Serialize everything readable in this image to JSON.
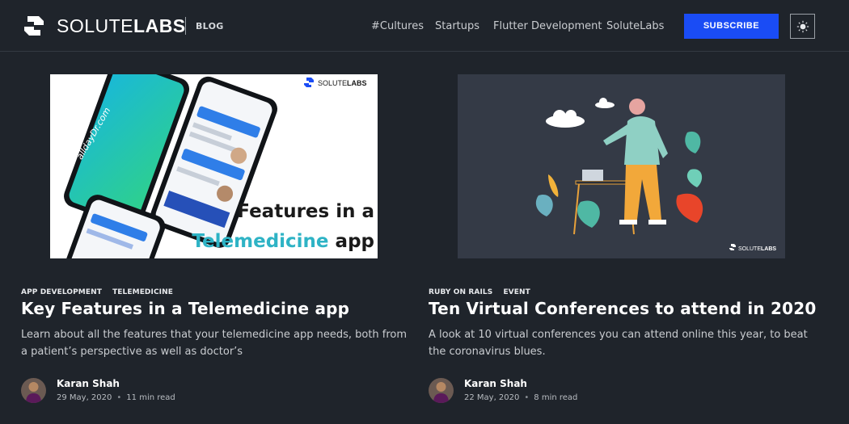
{
  "header": {
    "brand_light": "SOLUTE",
    "brand_bold": "LABS",
    "blog_label": "BLOG",
    "nav": [
      "#Cultures",
      "Startups",
      "Flutter Development",
      "SoluteLabs"
    ],
    "subscribe_label": "SUBSCRIBE",
    "accent_color": "#1a4cf5"
  },
  "posts": [
    {
      "image": {
        "badge_light": "SOLUTE",
        "badge_bold": "LABS",
        "phone_brand": "alldayDr.com",
        "headline_line1": "Features in a",
        "headline_word": "Telemedicine",
        "headline_end": "app",
        "headline_accent": "#2eb3c5"
      },
      "tags": [
        "APP DEVELOPMENT",
        "TELEMEDICINE"
      ],
      "title": "Key Features in a Telemedicine app",
      "excerpt": "Learn about all the features that your telemedicine app needs, both from a patient’s perspective as well as doctor’s",
      "author": "Karan Shah",
      "date": "29 May, 2020",
      "read_time": "11 min read"
    },
    {
      "image": {
        "badge_light": "SOLUTE",
        "badge_bold": "LABS"
      },
      "tags": [
        "RUBY ON RAILS",
        "EVENT"
      ],
      "title": "Ten Virtual Conferences to attend in 2020",
      "excerpt": "A look at 10 virtual conferences you can attend online this year, to beat the coronavirus blues.",
      "author": "Karan Shah",
      "date": "22 May, 2020",
      "read_time": "8 min read"
    }
  ]
}
